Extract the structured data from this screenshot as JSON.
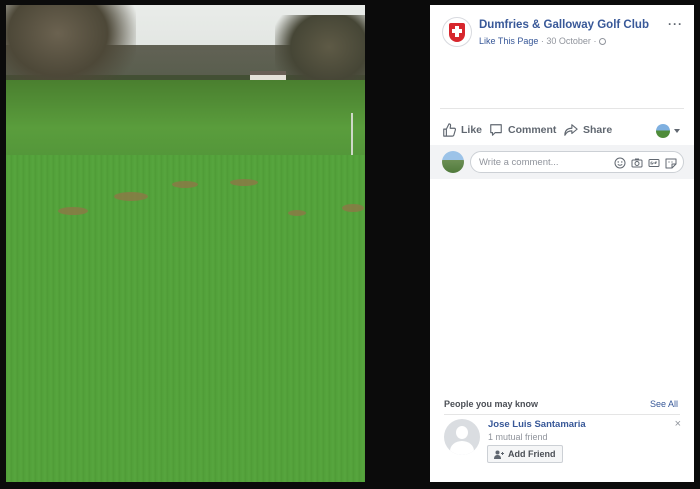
{
  "post": {
    "page_name": "Dumfries & Galloway Golf Club",
    "like_page": "Like This Page",
    "separator": "·",
    "date": "30 October",
    "more": "···"
  },
  "actions": {
    "like": "Like",
    "comment": "Comment",
    "share": "Share"
  },
  "comment_box": {
    "placeholder": "Write a comment..."
  },
  "people_you_may_know": {
    "title": "People you may know",
    "see_all": "See All",
    "person": {
      "name": "Jose Luis Santamaria",
      "mutual": "1 mutual friend",
      "add_friend": "Add Friend",
      "close": "×"
    }
  },
  "icons": {
    "logo": "club-crest-icon",
    "globe": "globe-icon",
    "like": "thumbs-up-icon",
    "comment": "comment-bubble-icon",
    "share": "share-arrow-icon",
    "emoji": "emoji-icon",
    "camera": "camera-icon",
    "gif": "gif-icon",
    "sticker": "sticker-icon",
    "add_friend": "add-friend-icon"
  },
  "colors": {
    "link_blue": "#385898",
    "meta_gray": "#90949c",
    "crest_red": "#d7262d"
  }
}
